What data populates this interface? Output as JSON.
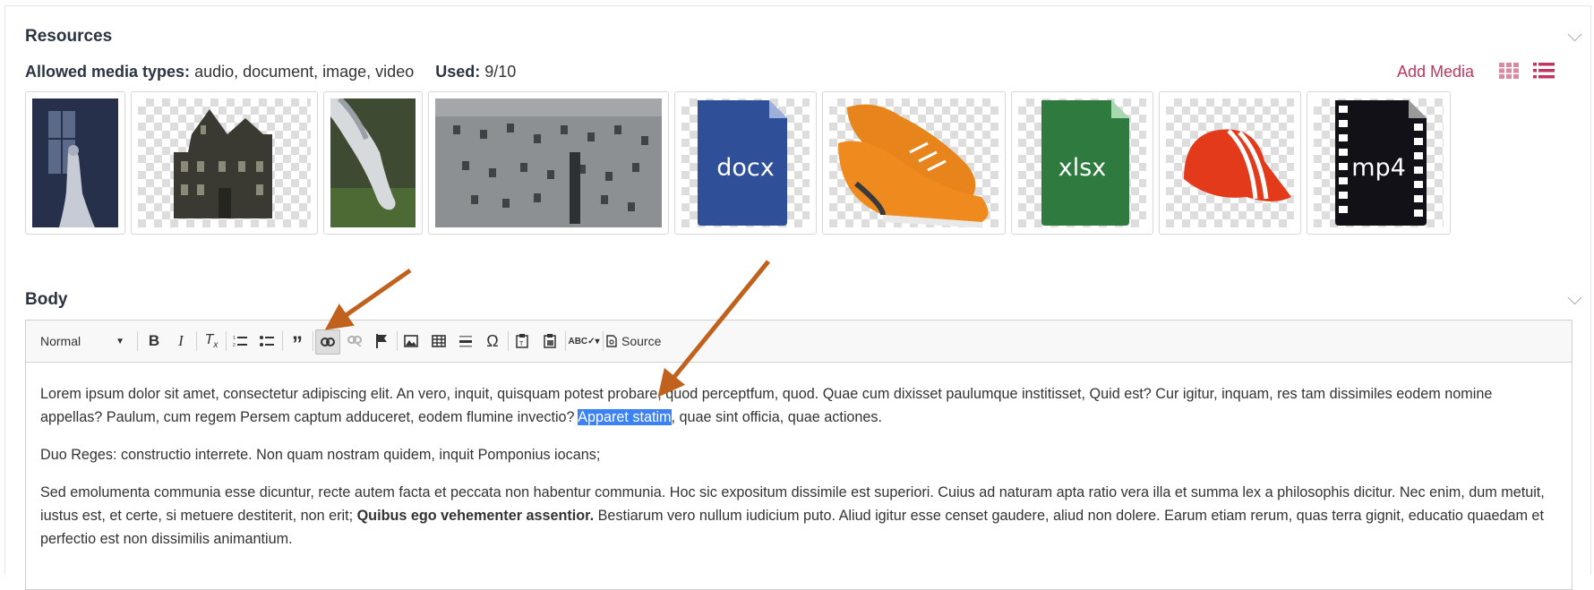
{
  "resources": {
    "heading": "Resources",
    "allowed_label": "Allowed media types:",
    "allowed_value": "audio, document, image, video",
    "used_label": "Used:",
    "used_value": "9/10",
    "add_media": "Add Media",
    "thumbnails": [
      {
        "name": "bride-window-image",
        "kind": "photo"
      },
      {
        "name": "haunted-house-image",
        "kind": "transparent"
      },
      {
        "name": "horse-image",
        "kind": "photo"
      },
      {
        "name": "building-facade-image",
        "kind": "photo"
      },
      {
        "name": "docx-file",
        "kind": "file",
        "label": "docx",
        "color": "#2f4f99"
      },
      {
        "name": "sneakers-image",
        "kind": "transparent"
      },
      {
        "name": "xlsx-file",
        "kind": "file",
        "label": "xlsx",
        "color": "#2f7a3e"
      },
      {
        "name": "red-cap-image",
        "kind": "transparent"
      },
      {
        "name": "mp4-file",
        "kind": "file",
        "label": "mp4",
        "color": "#111117"
      }
    ]
  },
  "body": {
    "heading": "Body",
    "toolbar": {
      "format_select": "Normal",
      "source_label": "Source"
    },
    "paragraphs": {
      "p1_before": "Lorem ipsum dolor sit amet, consectetur adipiscing elit. An vero, inquit, quisquam potest probare, quod perceptfum, quod. Quae cum dixisset paulumque institisset, Quid est? Cur igitur, inquam, res tam dissimiles eodem nomine appellas? Paulum, cum regem Persem captum adduceret, eodem flumine invectio? ",
      "p1_selected": "Apparet statim",
      "p1_after": ", quae sint officia, quae actiones.",
      "p2": "Duo Reges: constructio interrete. Non quam nostram quidem, inquit Pomponius iocans;",
      "p3_before": "Sed emolumenta communia esse dicuntur, recte autem facta et peccata non habentur communia. Hoc sic expositum dissimile est superiori. Cuius ad naturam apta ratio vera illa et summa lex a philosophis dicitur. Nec enim, dum metuit, iustus est, et certe, si metuere destiterit, non erit; ",
      "p3_bold": "Quibus ego vehementer assentior.",
      "p3_after": " Bestiarum vero nullum iudicium puto. Aliud igitur esse censet gaudere, aliud non dolere. Earum etiam rerum, quas terra gignit, educatio quaedam et perfectio est non dissimilis animantium."
    }
  },
  "colors": {
    "accent": "#c0365e",
    "annotation_arrow": "#c0621e",
    "selection": "#3b82f6"
  }
}
